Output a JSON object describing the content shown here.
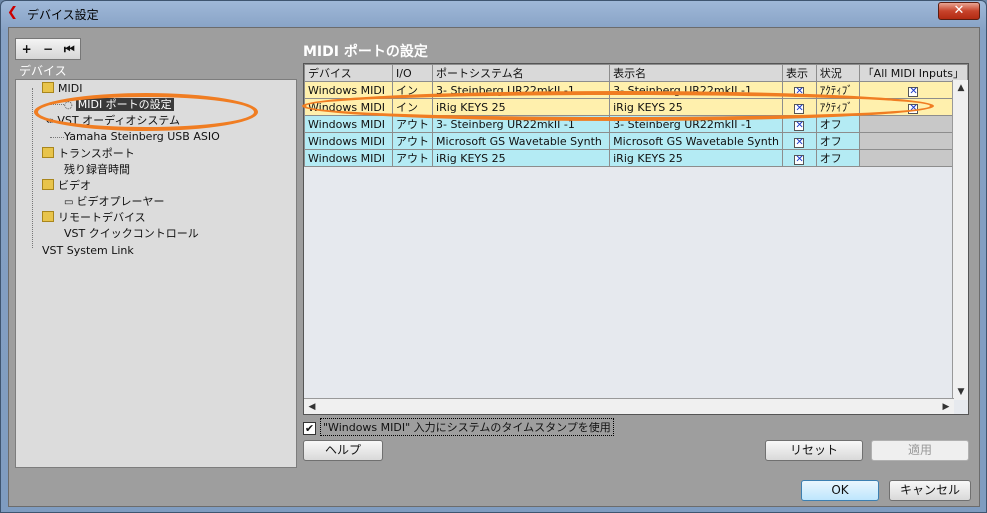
{
  "window": {
    "title": "デバイス設定",
    "close_label": "✕"
  },
  "toolbar": {
    "add": "+",
    "remove": "−",
    "reset": "⏮"
  },
  "tree": {
    "header": "デバイス",
    "items": [
      {
        "label": "MIDI",
        "type": "folder"
      },
      {
        "label": "MIDI ポートの設定",
        "type": "item",
        "selected": true
      },
      {
        "label": "VST オーディオシステム",
        "type": "item"
      },
      {
        "label": "Yamaha Steinberg USB ASIO",
        "type": "item"
      },
      {
        "label": "トランスポート",
        "type": "folder"
      },
      {
        "label": "残り録音時間",
        "type": "item"
      },
      {
        "label": "ビデオ",
        "type": "folder"
      },
      {
        "label": "ビデオプレーヤー",
        "type": "item"
      },
      {
        "label": "リモートデバイス",
        "type": "folder"
      },
      {
        "label": "VST クイックコントロール",
        "type": "item"
      },
      {
        "label": "VST System Link",
        "type": "item"
      }
    ]
  },
  "panel": {
    "title": "MIDI ポートの設定"
  },
  "grid": {
    "headers": [
      "デバイス",
      "I/O",
      "ポートシステム名",
      "表示名",
      "表示",
      "状況",
      "「All MIDI Inputs」"
    ],
    "rows": [
      {
        "device": "Windows MIDI",
        "io": "イン",
        "port": "3- Steinberg UR22mkII -1",
        "display": "3- Steinberg UR22mkII -1",
        "show": true,
        "status": "ｱｸﾃｨﾌﾞ",
        "all": true,
        "kind": "in"
      },
      {
        "device": "Windows MIDI",
        "io": "イン",
        "port": "iRig KEYS 25",
        "display": "iRig KEYS 25",
        "show": true,
        "status": "ｱｸﾃｨﾌﾞ",
        "all": true,
        "kind": "in"
      },
      {
        "device": "Windows MIDI",
        "io": "アウト",
        "port": "3- Steinberg UR22mkII -1",
        "display": "3- Steinberg UR22mkII -1",
        "show": true,
        "status": "オフ",
        "all": null,
        "kind": "out"
      },
      {
        "device": "Windows MIDI",
        "io": "アウト",
        "port": "Microsoft GS Wavetable Synth",
        "display": "Microsoft GS Wavetable Synth",
        "show": true,
        "status": "オフ",
        "all": null,
        "kind": "out"
      },
      {
        "device": "Windows MIDI",
        "io": "アウト",
        "port": "iRig KEYS 25",
        "display": "iRig KEYS 25",
        "show": true,
        "status": "オフ",
        "all": null,
        "kind": "out"
      }
    ]
  },
  "timestamp": {
    "checked": true,
    "label": "\"Windows MIDI\" 入力にシステムのタイムスタンプを使用"
  },
  "buttons": {
    "help": "ヘルプ",
    "reset": "リセット",
    "apply": "適用",
    "ok": "OK",
    "cancel": "キャンセル"
  },
  "colors": {
    "in_row": "#fff0ad",
    "out_row": "#b4ebf4",
    "highlight": "#f07d22"
  }
}
